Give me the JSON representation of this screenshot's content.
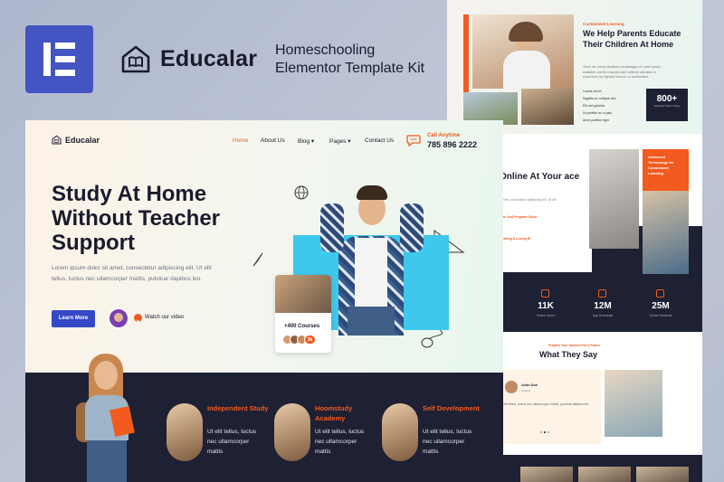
{
  "header": {
    "brand_name": "Educalar",
    "kit_line1": "Homeschooling",
    "kit_line2": "Elementor Template Kit"
  },
  "site": {
    "logo_text": "Educalar",
    "nav": [
      "Home",
      "About Us",
      "Blog ▾",
      "Pages ▾",
      "Contact Us"
    ],
    "call_label": "Call Anytime",
    "call_number": "785 896 2222"
  },
  "hero": {
    "title": "Study At Home Without Teacher Support",
    "description": "Lorem ipsum dolor sit amet, consectetur adipiscing elit. Ut elit tellus, luctus nec ullamcorper mattis, pulvinar dapibus leo.",
    "cta_label": "Learn More",
    "video_label": "Watch our video",
    "courses_label": "+400 Courses",
    "avatar_count": "3k"
  },
  "features": [
    {
      "title": "Independent Study",
      "text": "Ut elit tellus, luctus nec ullamcorper mattis"
    },
    {
      "title": "Hoomstudy Academy",
      "text": "Ut elit tellus, luctus nec ullamcorper mattis"
    },
    {
      "title": "Self Development",
      "text": "Ut elit tellus, luctus nec ullamcorper mattis"
    }
  ],
  "right_panel": {
    "tag": "Customized Learning",
    "title": "We Help Parents Educate Their Children At Home",
    "description": "There are many variations of passages of Lorem Ipsum available, but the majority have suffered alteration in some form, by injected humour, or randomised.",
    "list": [
      "Luctus nisl et",
      "Sagittis ac volutpat odio",
      "Elit sed gravida",
      "Ut porttitor ac a justo",
      "Amet porttitor eget"
    ],
    "stat_number": "800+",
    "stat_label": "Satisfied Parent Says",
    "section2_title": "Online At Your ace",
    "section2_desc": "t amet, consectetur adipiscing elit. Ut elit",
    "section2_link1": "Plan And Program Guide",
    "section2_link2": "Reading & Loving Et",
    "orange_box": "Advanced Technology for Customized Learning",
    "stats": [
      {
        "number": "11K",
        "label": "Online Hours"
      },
      {
        "number": "12M",
        "label": "App Download"
      },
      {
        "number": "25M",
        "label": "Online Students"
      }
    ],
    "testimonial_tag": "Prepare Your Student For A Future",
    "testimonial_title": "What They Say",
    "testimonial_name": "John Doe",
    "testimonial_role": "Student",
    "testimonial_text": "Ut elit tellus, luctus nec ullamcorper mattis, pulvinar dapibus leo."
  },
  "colors": {
    "accent": "#f25a1f",
    "primary": "#3548c8",
    "dark": "#1e2033",
    "elementor": "#4454c3",
    "sky": "#3ec8ec"
  }
}
